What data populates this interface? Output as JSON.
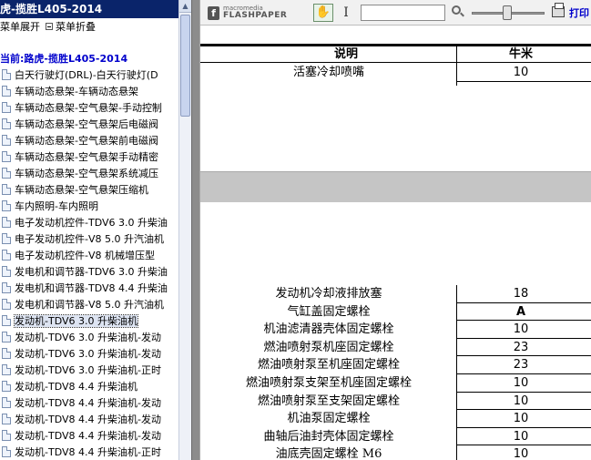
{
  "nav": {
    "title": "虎-揽胜L405-2014",
    "expand_label": "菜单展开",
    "collapse_label": "菜单折叠",
    "current": "当前:路虎-揽胜L405-2014",
    "items": [
      {
        "label": "白天行驶灯(DRL)-白天行驶灯(D"
      },
      {
        "label": "车辆动态悬架-车辆动态悬架"
      },
      {
        "label": "车辆动态悬架-空气悬架-手动控制"
      },
      {
        "label": "车辆动态悬架-空气悬架后电磁阀"
      },
      {
        "label": "车辆动态悬架-空气悬架前电磁阀"
      },
      {
        "label": "车辆动态悬架-空气悬架手动精密"
      },
      {
        "label": "车辆动态悬架-空气悬架系统减压"
      },
      {
        "label": "车辆动态悬架-空气悬架压缩机"
      },
      {
        "label": "车内照明-车内照明"
      },
      {
        "label": "电子发动机控件-TDV6 3.0 升柴油"
      },
      {
        "label": "电子发动机控件-V8 5.0 升汽油机"
      },
      {
        "label": "电子发动机控件-V8 机械增压型"
      },
      {
        "label": "发电机和调节器-TDV6 3.0 升柴油"
      },
      {
        "label": "发电机和调节器-TDV8 4.4 升柴油"
      },
      {
        "label": "发电机和调节器-V8 5.0 升汽油机"
      },
      {
        "label": "发动机-TDV6 3.0 升柴油机",
        "selected": true
      },
      {
        "label": "发动机-TDV6 3.0 升柴油机-发动"
      },
      {
        "label": "发动机-TDV6 3.0 升柴油机-发动"
      },
      {
        "label": "发动机-TDV6 3.0 升柴油机-正时"
      },
      {
        "label": "发动机-TDV8 4.4 升柴油机"
      },
      {
        "label": "发动机-TDV8 4.4 升柴油机-发动"
      },
      {
        "label": "发动机-TDV8 4.4 升柴油机-发动"
      },
      {
        "label": "发动机-TDV8 4.4 升柴油机-发动"
      },
      {
        "label": "发动机-TDV8 4.4 升柴油机-正时"
      }
    ]
  },
  "viewer": {
    "logo_small": "macromedia",
    "logo_big": "FLASHPAPER",
    "print_label": "打印",
    "find_placeholder": "",
    "table": {
      "col_desc": "说明",
      "col_nm": "牛米",
      "rows_top": [
        {
          "desc": "活塞冷却喷嘴",
          "value": "10"
        }
      ],
      "rows_bottom": [
        {
          "desc": "发动机冷却液排放塞",
          "value": "18"
        },
        {
          "desc": "气缸盖固定螺栓",
          "value": "A",
          "bold": true
        },
        {
          "desc": "机油滤清器壳体固定螺栓",
          "value": "10"
        },
        {
          "desc": "燃油喷射泵机座固定螺栓",
          "value": "23"
        },
        {
          "desc": "燃油喷射泵至机座固定螺栓",
          "value": "23"
        },
        {
          "desc": "燃油喷射泵支架至机座固定螺栓",
          "value": "10"
        },
        {
          "desc": "燃油喷射泵至支架固定螺栓",
          "value": "10"
        },
        {
          "desc": "机油泵固定螺栓",
          "value": "10"
        },
        {
          "desc": "曲轴后油封壳体固定螺栓",
          "value": "10"
        },
        {
          "desc": "油底壳固定螺栓 M6",
          "value": "10"
        }
      ]
    }
  }
}
